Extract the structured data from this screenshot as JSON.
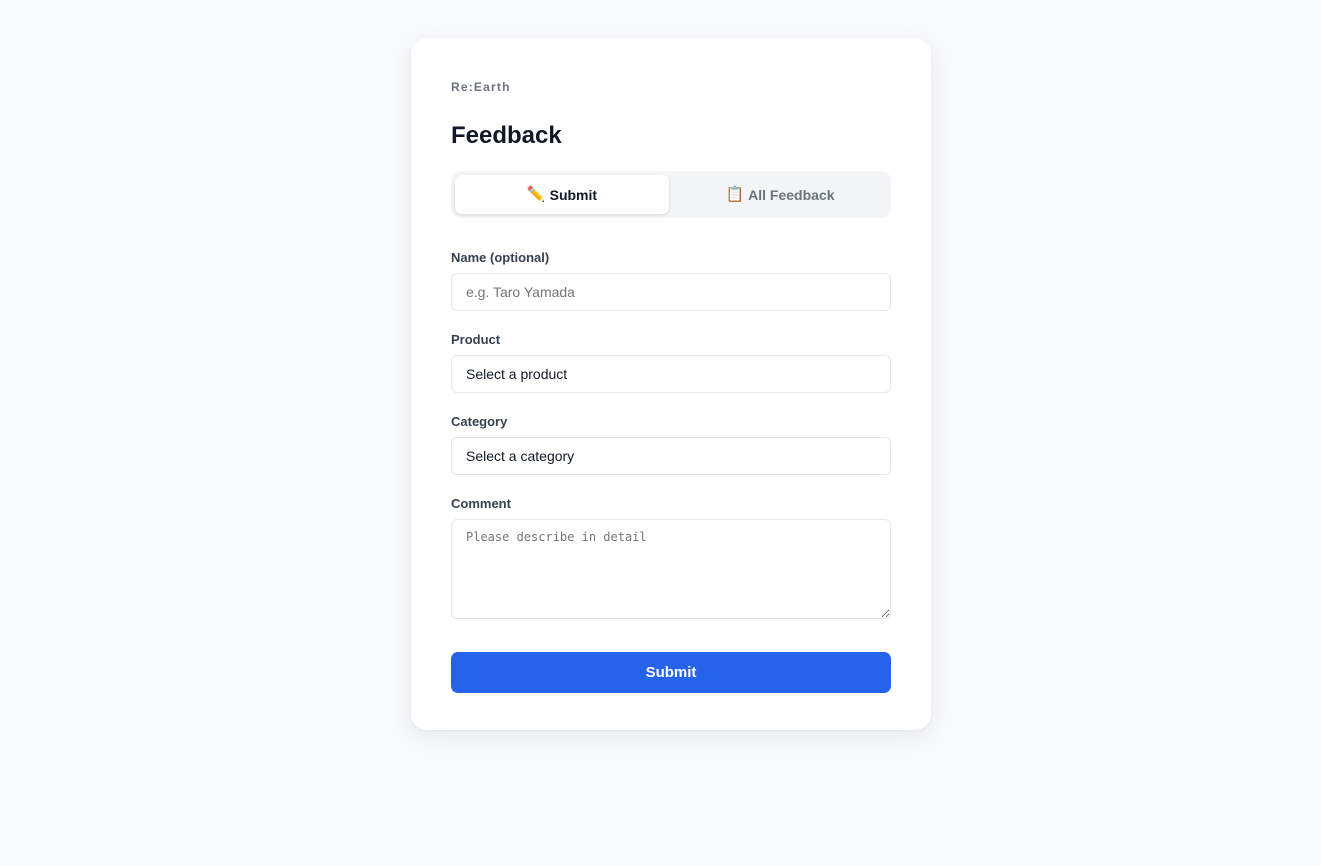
{
  "brand": "Re:Earth",
  "title": "Feedback",
  "tabs": [
    {
      "icon": "pencil-icon",
      "glyph": "✏️",
      "label": "Submit",
      "active": true
    },
    {
      "icon": "clipboard-icon",
      "glyph": "📋",
      "label": "All Feedback",
      "active": false
    }
  ],
  "form": {
    "name": {
      "label": "Name (optional)",
      "placeholder": "e.g. Taro Yamada",
      "value": ""
    },
    "product": {
      "label": "Product",
      "value": "Select a product"
    },
    "category": {
      "label": "Category",
      "value": "Select a category"
    },
    "comment": {
      "label": "Comment",
      "placeholder": "Please describe in detail",
      "value": ""
    },
    "submit_label": "Submit"
  },
  "colors": {
    "accent": "#2563eb",
    "background": "#f8f9fb",
    "card": "#ffffff",
    "title": "#111827",
    "muted": "#6b7280"
  }
}
